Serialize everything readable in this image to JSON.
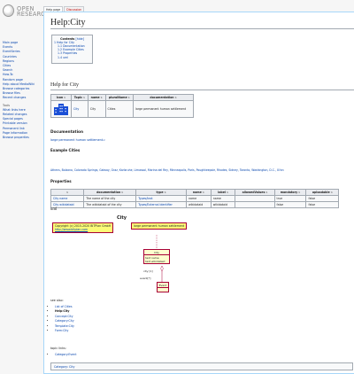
{
  "logo": {
    "word1": "OPEN",
    "word2": "RESEARCH"
  },
  "sidebar": {
    "nav": [
      "Main page",
      "Events",
      "EventSeries",
      "Countries",
      "Regions",
      "Cities",
      "Search",
      "How-To",
      "Random page",
      "Help about MediaWiki",
      "Browse categories",
      "Browse files",
      "Recent changes"
    ],
    "tools_heading": "Tools",
    "tools": [
      "What links here",
      "Related changes",
      "Special pages",
      "Printable version",
      "Permanent link",
      "Page information",
      "Browse properties"
    ]
  },
  "tabs": {
    "page": "Help page",
    "discussion": "Discussion"
  },
  "page": {
    "title": "Help:City"
  },
  "toc": {
    "title": "Contents",
    "hide": "[hide]",
    "items": [
      {
        "num": "1",
        "label": "Help for City"
      },
      {
        "num": "1.1",
        "label": "Documentation"
      },
      {
        "num": "1.2",
        "label": "Example Cities"
      },
      {
        "num": "1.3",
        "label": "Properties"
      },
      {
        "num": "1.4",
        "label": "uml"
      }
    ]
  },
  "section_help": {
    "heading": "Help for City"
  },
  "topic_table": {
    "headers": [
      "Icon",
      "Topic",
      "name",
      "pluralName",
      "documentation"
    ],
    "row": {
      "topic": "City",
      "name": "City",
      "plural": "Cities",
      "documentation": "large permanent human settlement"
    }
  },
  "documentation": {
    "heading": "Documentation",
    "text": "large permanent human settlement⇒"
  },
  "examples": {
    "heading": "Example Cities",
    "text": "Athens, Bolzano, Colorado Springs, Galway, Graz, Karlsruhe, Limassol, Marina del Rey, Minneapolis, Paris, Poughkeepsie, Rhodes, Sidney, Toronto, Washington, D.C., Xi'an"
  },
  "properties": {
    "heading": "Properties",
    "headers": [
      "",
      "documentation",
      "type",
      "name",
      "label",
      "allowedValues",
      "mandatory",
      "uploadable"
    ],
    "rows": [
      [
        "City name",
        "The name of the city",
        "Types/text",
        "name",
        "name",
        "",
        "true",
        "false"
      ],
      [
        "City wikidataid",
        "The wikidataid of the city",
        "Types/External identifier",
        "wikidataid",
        "wikidataid",
        "",
        "false",
        "false"
      ]
    ]
  },
  "uml": {
    "heading": "uml",
    "diagram_title": "City",
    "copyright_line1": "Copyright (c) 2015-2020 BITPlan GmbH",
    "copyright_line2": "http://www.bitplan.com",
    "doc_note": "large permanent human settlement",
    "class_name": "City",
    "class_attrs": [
      "text name",
      "text wikidataid"
    ],
    "rel_label1": "city [1]",
    "rel_label2": "event[*]",
    "event_class": "Event"
  },
  "see_also": {
    "label": "see also:",
    "items": [
      "List of Cities",
      "Help:City",
      "Concept:City",
      "Category:City",
      "Template:City",
      "Form:City"
    ]
  },
  "topic_links": {
    "label": "topic links:",
    "items": [
      "Category:Event"
    ]
  },
  "categories": {
    "label": "Category:",
    "value": "City"
  }
}
